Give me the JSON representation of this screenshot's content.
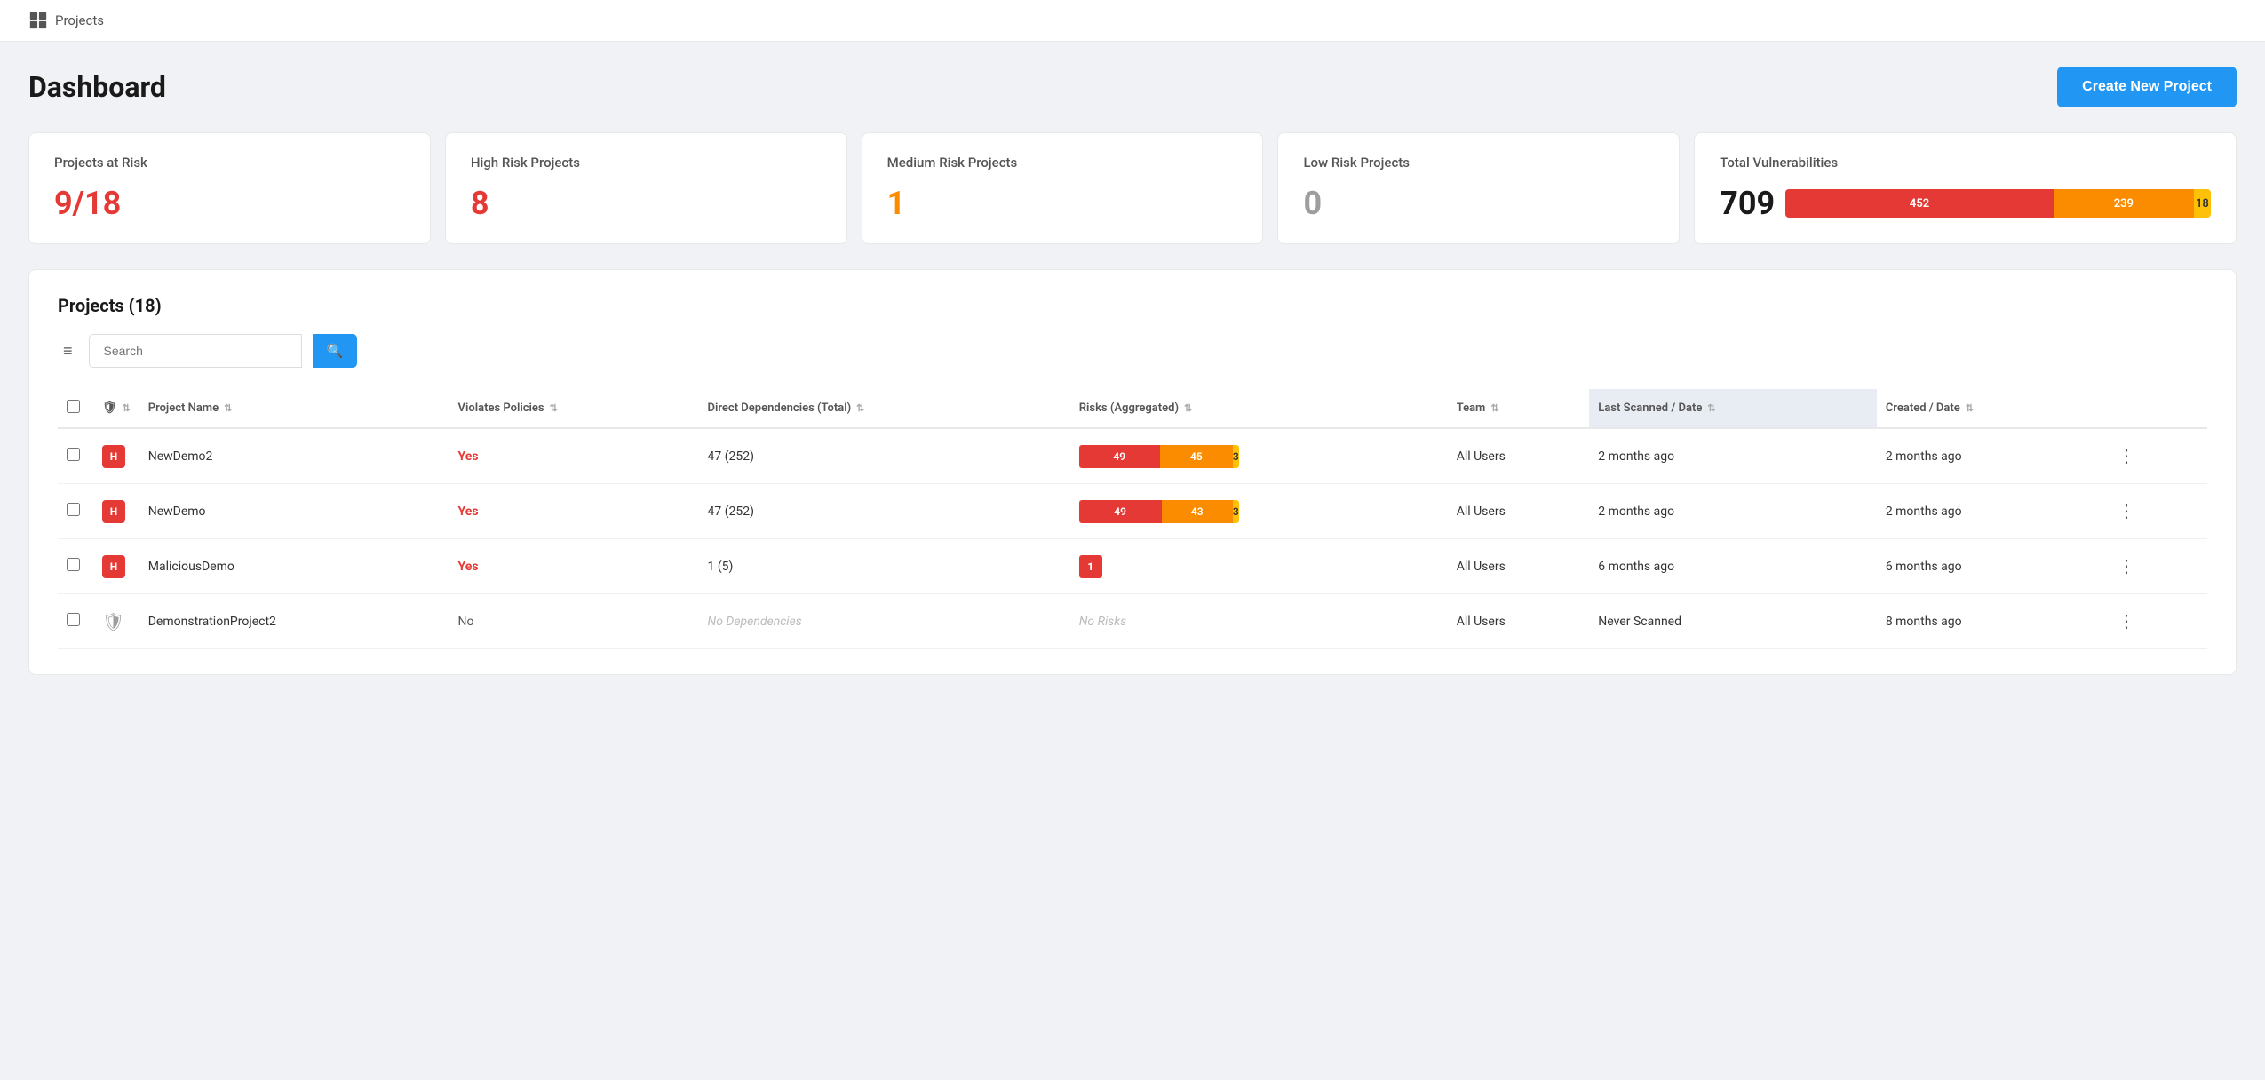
{
  "app": {
    "brand_label": "Projects",
    "page_title": "Dashboard",
    "create_button": "Create New Project"
  },
  "stats": {
    "at_risk": {
      "label": "Projects at Risk",
      "value": "9/18",
      "color": "red"
    },
    "high_risk": {
      "label": "High Risk Projects",
      "value": "8",
      "color": "red"
    },
    "medium_risk": {
      "label": "Medium Risk Projects",
      "value": "1",
      "color": "orange"
    },
    "low_risk": {
      "label": "Low Risk Projects",
      "value": "0",
      "color": "gray"
    },
    "vulnerabilities": {
      "label": "Total Vulnerabilities",
      "total": "709",
      "segments": [
        {
          "label": "452",
          "pct": 63,
          "class": "seg-red"
        },
        {
          "label": "239",
          "pct": 33,
          "class": "seg-orange"
        },
        {
          "label": "18",
          "pct": 4,
          "class": "seg-yellow"
        }
      ]
    }
  },
  "projects_section": {
    "title": "Projects (18)",
    "search_placeholder": "Search",
    "filter_icon": "≡",
    "search_icon": "🔍",
    "columns": [
      {
        "label": "",
        "key": "checkbox"
      },
      {
        "label": "",
        "key": "risk_icon"
      },
      {
        "label": "Project Name",
        "key": "name",
        "sortable": true
      },
      {
        "label": "Violates Policies",
        "key": "violates",
        "sortable": true
      },
      {
        "label": "Direct Dependencies (Total)",
        "key": "deps",
        "sortable": true
      },
      {
        "label": "Risks (Aggregated)",
        "key": "risks",
        "sortable": true
      },
      {
        "label": "Team",
        "key": "team",
        "sortable": true
      },
      {
        "label": "Last Scanned / Date",
        "key": "last_scanned",
        "sortable": true,
        "sorted": true
      },
      {
        "label": "Created / Date",
        "key": "created",
        "sortable": true
      }
    ],
    "rows": [
      {
        "id": 1,
        "risk_level": "H",
        "name": "NewDemo2",
        "violates": "Yes",
        "violates_type": "yes",
        "deps": "47 (252)",
        "risks_type": "bar",
        "risks_red": "49",
        "risks_orange": "45",
        "risks_yellow": "3",
        "risks_red_pct": 51,
        "risks_orange_pct": 46,
        "risks_yellow_pct": 3,
        "team": "All Users",
        "last_scanned": "2 months ago",
        "created": "2 months ago"
      },
      {
        "id": 2,
        "risk_level": "H",
        "name": "NewDemo",
        "violates": "Yes",
        "violates_type": "yes",
        "deps": "47 (252)",
        "risks_type": "bar",
        "risks_red": "49",
        "risks_orange": "43",
        "risks_yellow": "3",
        "risks_red_pct": 52,
        "risks_orange_pct": 45,
        "risks_yellow_pct": 3,
        "team": "All Users",
        "last_scanned": "2 months ago",
        "created": "2 months ago"
      },
      {
        "id": 3,
        "risk_level": "H",
        "name": "MaliciousDemo",
        "violates": "Yes",
        "violates_type": "yes",
        "deps": "1 (5)",
        "risks_type": "single",
        "risks_red": "1",
        "team": "All Users",
        "last_scanned": "6 months ago",
        "created": "6 months ago"
      },
      {
        "id": 4,
        "risk_level": "none",
        "name": "DemonstrationProject2",
        "violates": "No",
        "violates_type": "no",
        "deps": "No Dependencies",
        "deps_type": "empty",
        "risks_type": "empty",
        "team": "All Users",
        "last_scanned": "Never Scanned",
        "created": "8 months ago"
      }
    ]
  }
}
